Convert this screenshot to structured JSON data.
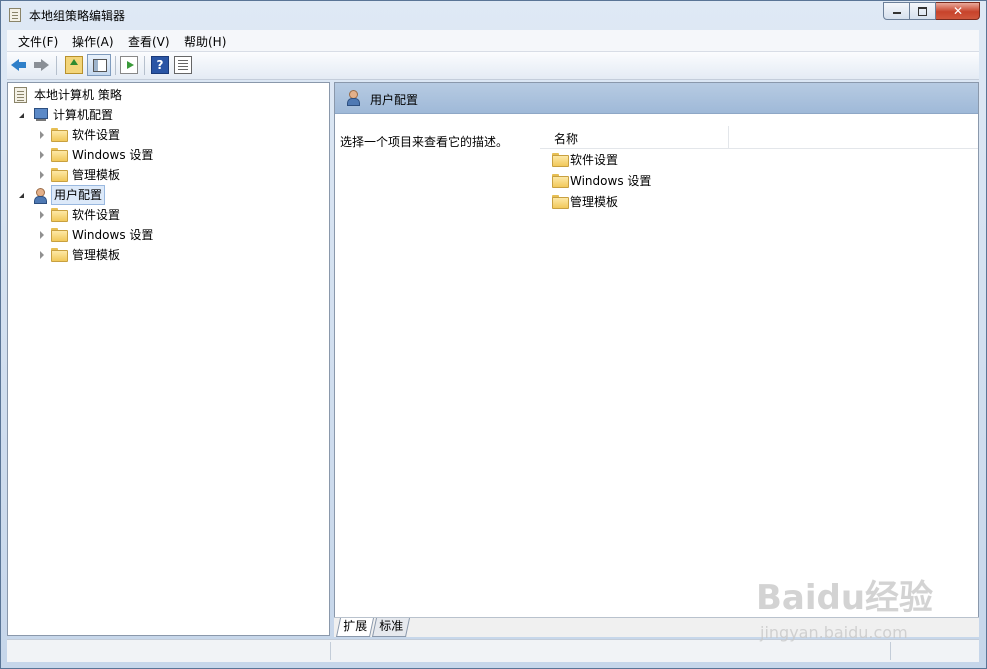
{
  "window": {
    "title": "本地组策略编辑器",
    "caption_close": "✕"
  },
  "menu": [
    "文件(F)",
    "操作(A)",
    "查看(V)",
    "帮助(H)"
  ],
  "toolbar": {
    "help_glyph": "?"
  },
  "tree": {
    "root": "本地计算机 策略",
    "computer_config": "计算机配置",
    "computer_children": [
      "软件设置",
      "Windows 设置",
      "管理模板"
    ],
    "user_config": "用户配置",
    "user_children": [
      "软件设置",
      "Windows 设置",
      "管理模板"
    ]
  },
  "right_pane": {
    "title": "用户配置",
    "description": "选择一个项目来查看它的描述。",
    "column_name": "名称",
    "items": [
      "软件设置",
      "Windows 设置",
      "管理模板"
    ]
  },
  "tabs": [
    "扩展",
    "标准"
  ],
  "watermark": {
    "brand": "Baidu经验",
    "url": "jingyan.baidu.com"
  }
}
